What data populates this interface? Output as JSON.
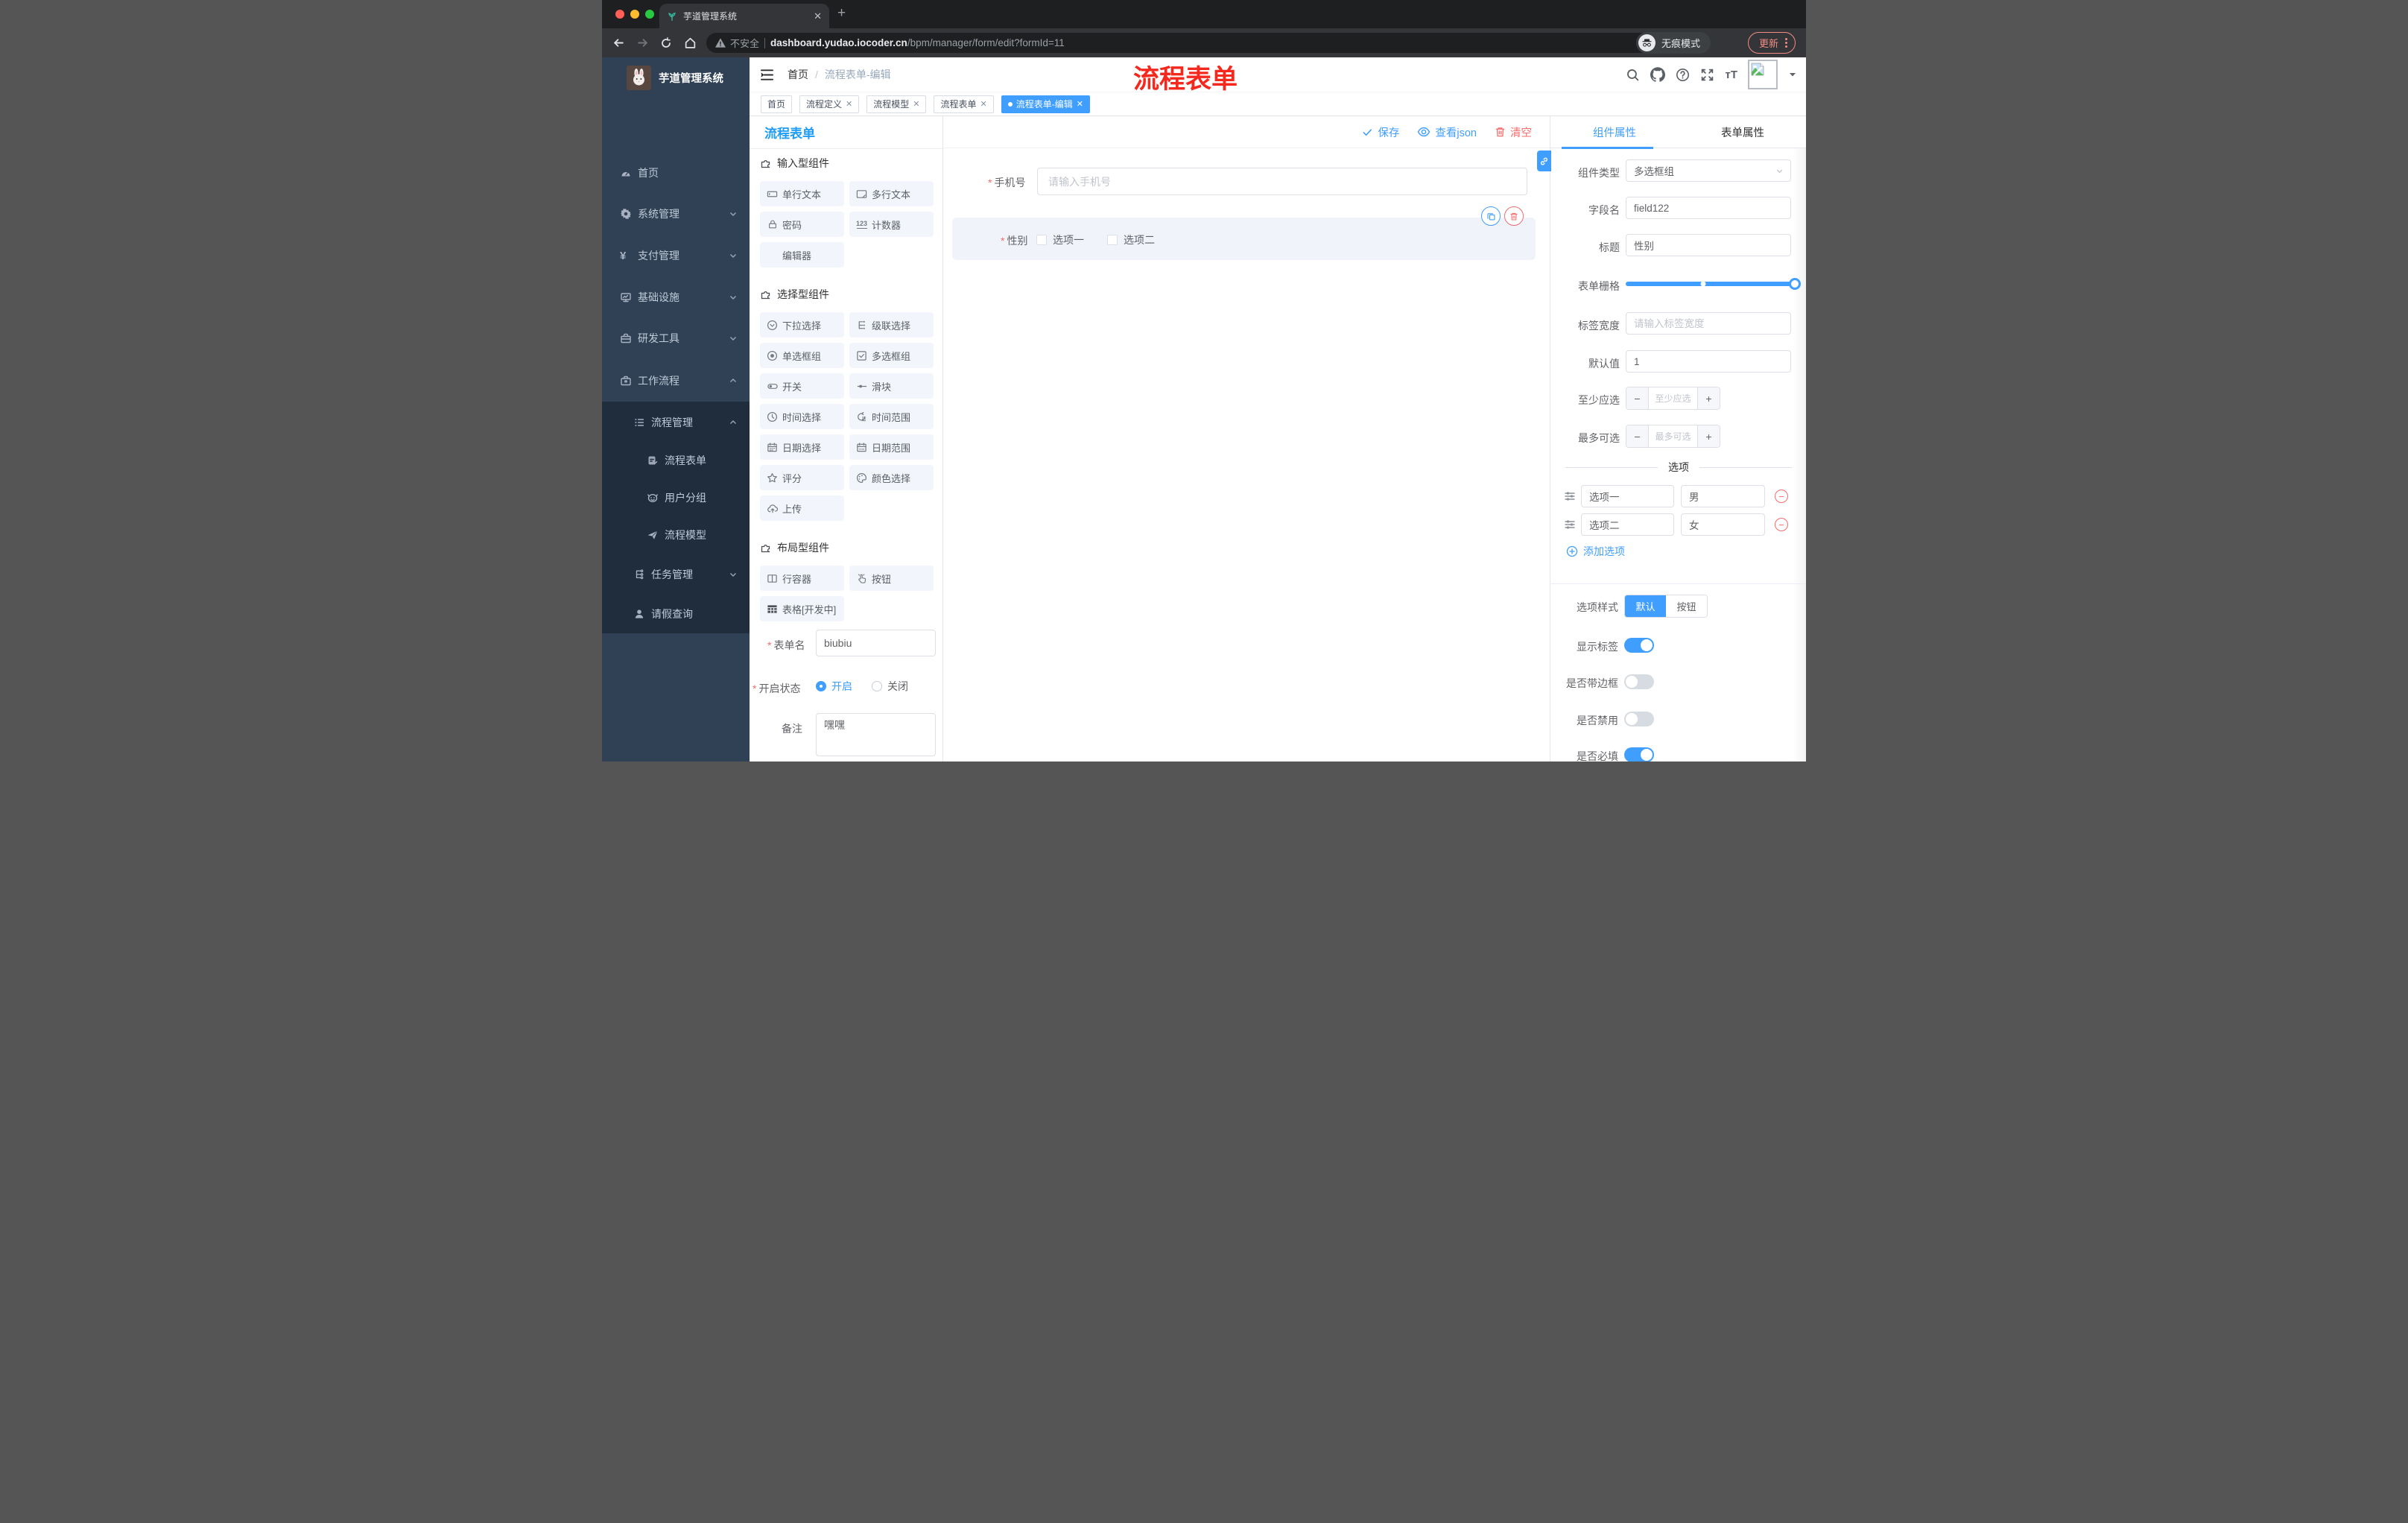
{
  "colors": {
    "accent": "#409eff",
    "danger": "#f56c6c",
    "annotation": "#f5281d",
    "sidebar_bg": "#304156",
    "submenu_bg": "#1f2d3d",
    "update_red": "#f28b82"
  },
  "browser": {
    "tab_title": "芋道管理系统",
    "security_label": "不安全",
    "url_host": "dashboard.yudao.iocoder.cn",
    "url_path": "/bpm/manager/form/edit?formId=11",
    "incognito_label": "无痕模式",
    "update_label": "更新"
  },
  "sidebar": {
    "brand": "芋道管理系统",
    "items": [
      {
        "label": "首页"
      },
      {
        "label": "系统管理"
      },
      {
        "label": "支付管理"
      },
      {
        "label": "基础设施"
      },
      {
        "label": "研发工具"
      },
      {
        "label": "工作流程"
      }
    ],
    "submenu": [
      {
        "label": "流程管理"
      },
      {
        "label": "流程表单"
      },
      {
        "label": "用户分组"
      },
      {
        "label": "流程模型"
      },
      {
        "label": "任务管理"
      },
      {
        "label": "请假查询"
      }
    ]
  },
  "header": {
    "breadcrumb_home": "首页",
    "breadcrumb_sep": "/",
    "breadcrumb_current": "流程表单-编辑",
    "annotation": "流程表单"
  },
  "tags": [
    {
      "label": "首页"
    },
    {
      "label": "流程定义"
    },
    {
      "label": "流程模型"
    },
    {
      "label": "流程表单"
    },
    {
      "label": "流程表单-编辑"
    }
  ],
  "builder": {
    "panel_title": "流程表单",
    "sections": [
      {
        "title": "输入型组件",
        "items": [
          {
            "label": "单行文本"
          },
          {
            "label": "多行文本"
          },
          {
            "label": "密码"
          },
          {
            "label": "计数器"
          },
          {
            "label": "编辑器"
          }
        ]
      },
      {
        "title": "选择型组件",
        "items": [
          {
            "label": "下拉选择"
          },
          {
            "label": "级联选择"
          },
          {
            "label": "单选框组"
          },
          {
            "label": "多选框组"
          },
          {
            "label": "开关"
          },
          {
            "label": "滑块"
          },
          {
            "label": "时间选择"
          },
          {
            "label": "时间范围"
          },
          {
            "label": "日期选择"
          },
          {
            "label": "日期范围"
          },
          {
            "label": "评分"
          },
          {
            "label": "颜色选择"
          },
          {
            "label": "上传"
          }
        ]
      },
      {
        "title": "布局型组件",
        "items": [
          {
            "label": "行容器"
          },
          {
            "label": "按钮"
          },
          {
            "label": "表格[开发中]"
          }
        ]
      }
    ],
    "meta": {
      "form_name_label": "表单名",
      "form_name_value": "biubiu",
      "status_label": "开启状态",
      "status_on": "开启",
      "status_off": "关闭",
      "remark_label": "备注",
      "remark_value": "嘿嘿"
    }
  },
  "canvas": {
    "toolbar": {
      "save": "保存",
      "view_json": "查看json",
      "clear": "清空"
    },
    "phone_field": {
      "label": "手机号",
      "placeholder": "请输入手机号"
    },
    "gender_field": {
      "label": "性别",
      "option1": "选项一",
      "option2": "选项二"
    }
  },
  "props": {
    "tab_component": "组件属性",
    "tab_form": "表单属性",
    "component_type": {
      "label": "组件类型",
      "value": "多选框组"
    },
    "field_name": {
      "label": "字段名",
      "value": "field122"
    },
    "title": {
      "label": "标题",
      "value": "性别"
    },
    "grid": {
      "label": "表单栅格"
    },
    "label_width": {
      "label": "标签宽度",
      "placeholder": "请输入标签宽度"
    },
    "default_value": {
      "label": "默认值",
      "value": "1"
    },
    "min_select": {
      "label": "至少应选",
      "placeholder": "至少应选"
    },
    "max_select": {
      "label": "最多可选",
      "placeholder": "最多可选"
    },
    "options_title": "选项",
    "options": [
      {
        "label": "选项一",
        "value": "男"
      },
      {
        "label": "选项二",
        "value": "女"
      }
    ],
    "add_option": "添加选项",
    "option_style": {
      "label": "选项样式",
      "opt_default": "默认",
      "opt_button": "按钮"
    },
    "toggles": [
      {
        "label": "显示标签",
        "state": "on"
      },
      {
        "label": "是否带边框",
        "state": "off"
      },
      {
        "label": "是否禁用",
        "state": "off"
      },
      {
        "label": "是否必填",
        "state": "on"
      }
    ]
  }
}
